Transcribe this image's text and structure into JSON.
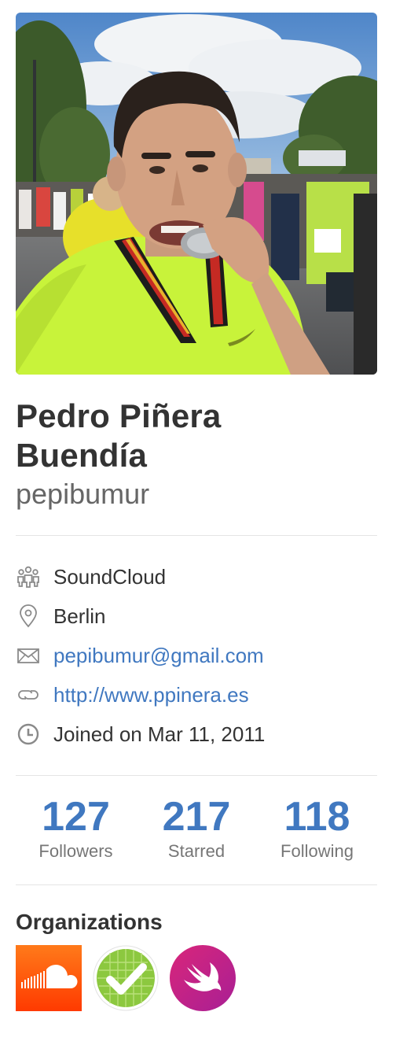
{
  "profile": {
    "full_name_line1": "Pedro Piñera",
    "full_name_line2": "Buendía",
    "username": "pepibumur"
  },
  "details": {
    "company": "SoundCloud",
    "location": "Berlin",
    "email": "pepibumur@gmail.com",
    "website": "http://www.ppinera.es",
    "joined": "Joined on Mar 11, 2011"
  },
  "stats": {
    "followers": {
      "value": "127",
      "label": "Followers"
    },
    "starred": {
      "value": "217",
      "label": "Starred"
    },
    "following": {
      "value": "118",
      "label": "Following"
    }
  },
  "organizations": {
    "title": "Organizations",
    "items": [
      {
        "icon": "soundcloud-logo"
      },
      {
        "icon": "green-check-grid-logo"
      },
      {
        "icon": "swift-logo"
      }
    ]
  },
  "colors": {
    "link": "#4078c0",
    "text": "#333333",
    "muted": "#767676",
    "divider": "#e5e5e5",
    "soundcloud": "#ff5500",
    "swift": "#c21f8a"
  }
}
